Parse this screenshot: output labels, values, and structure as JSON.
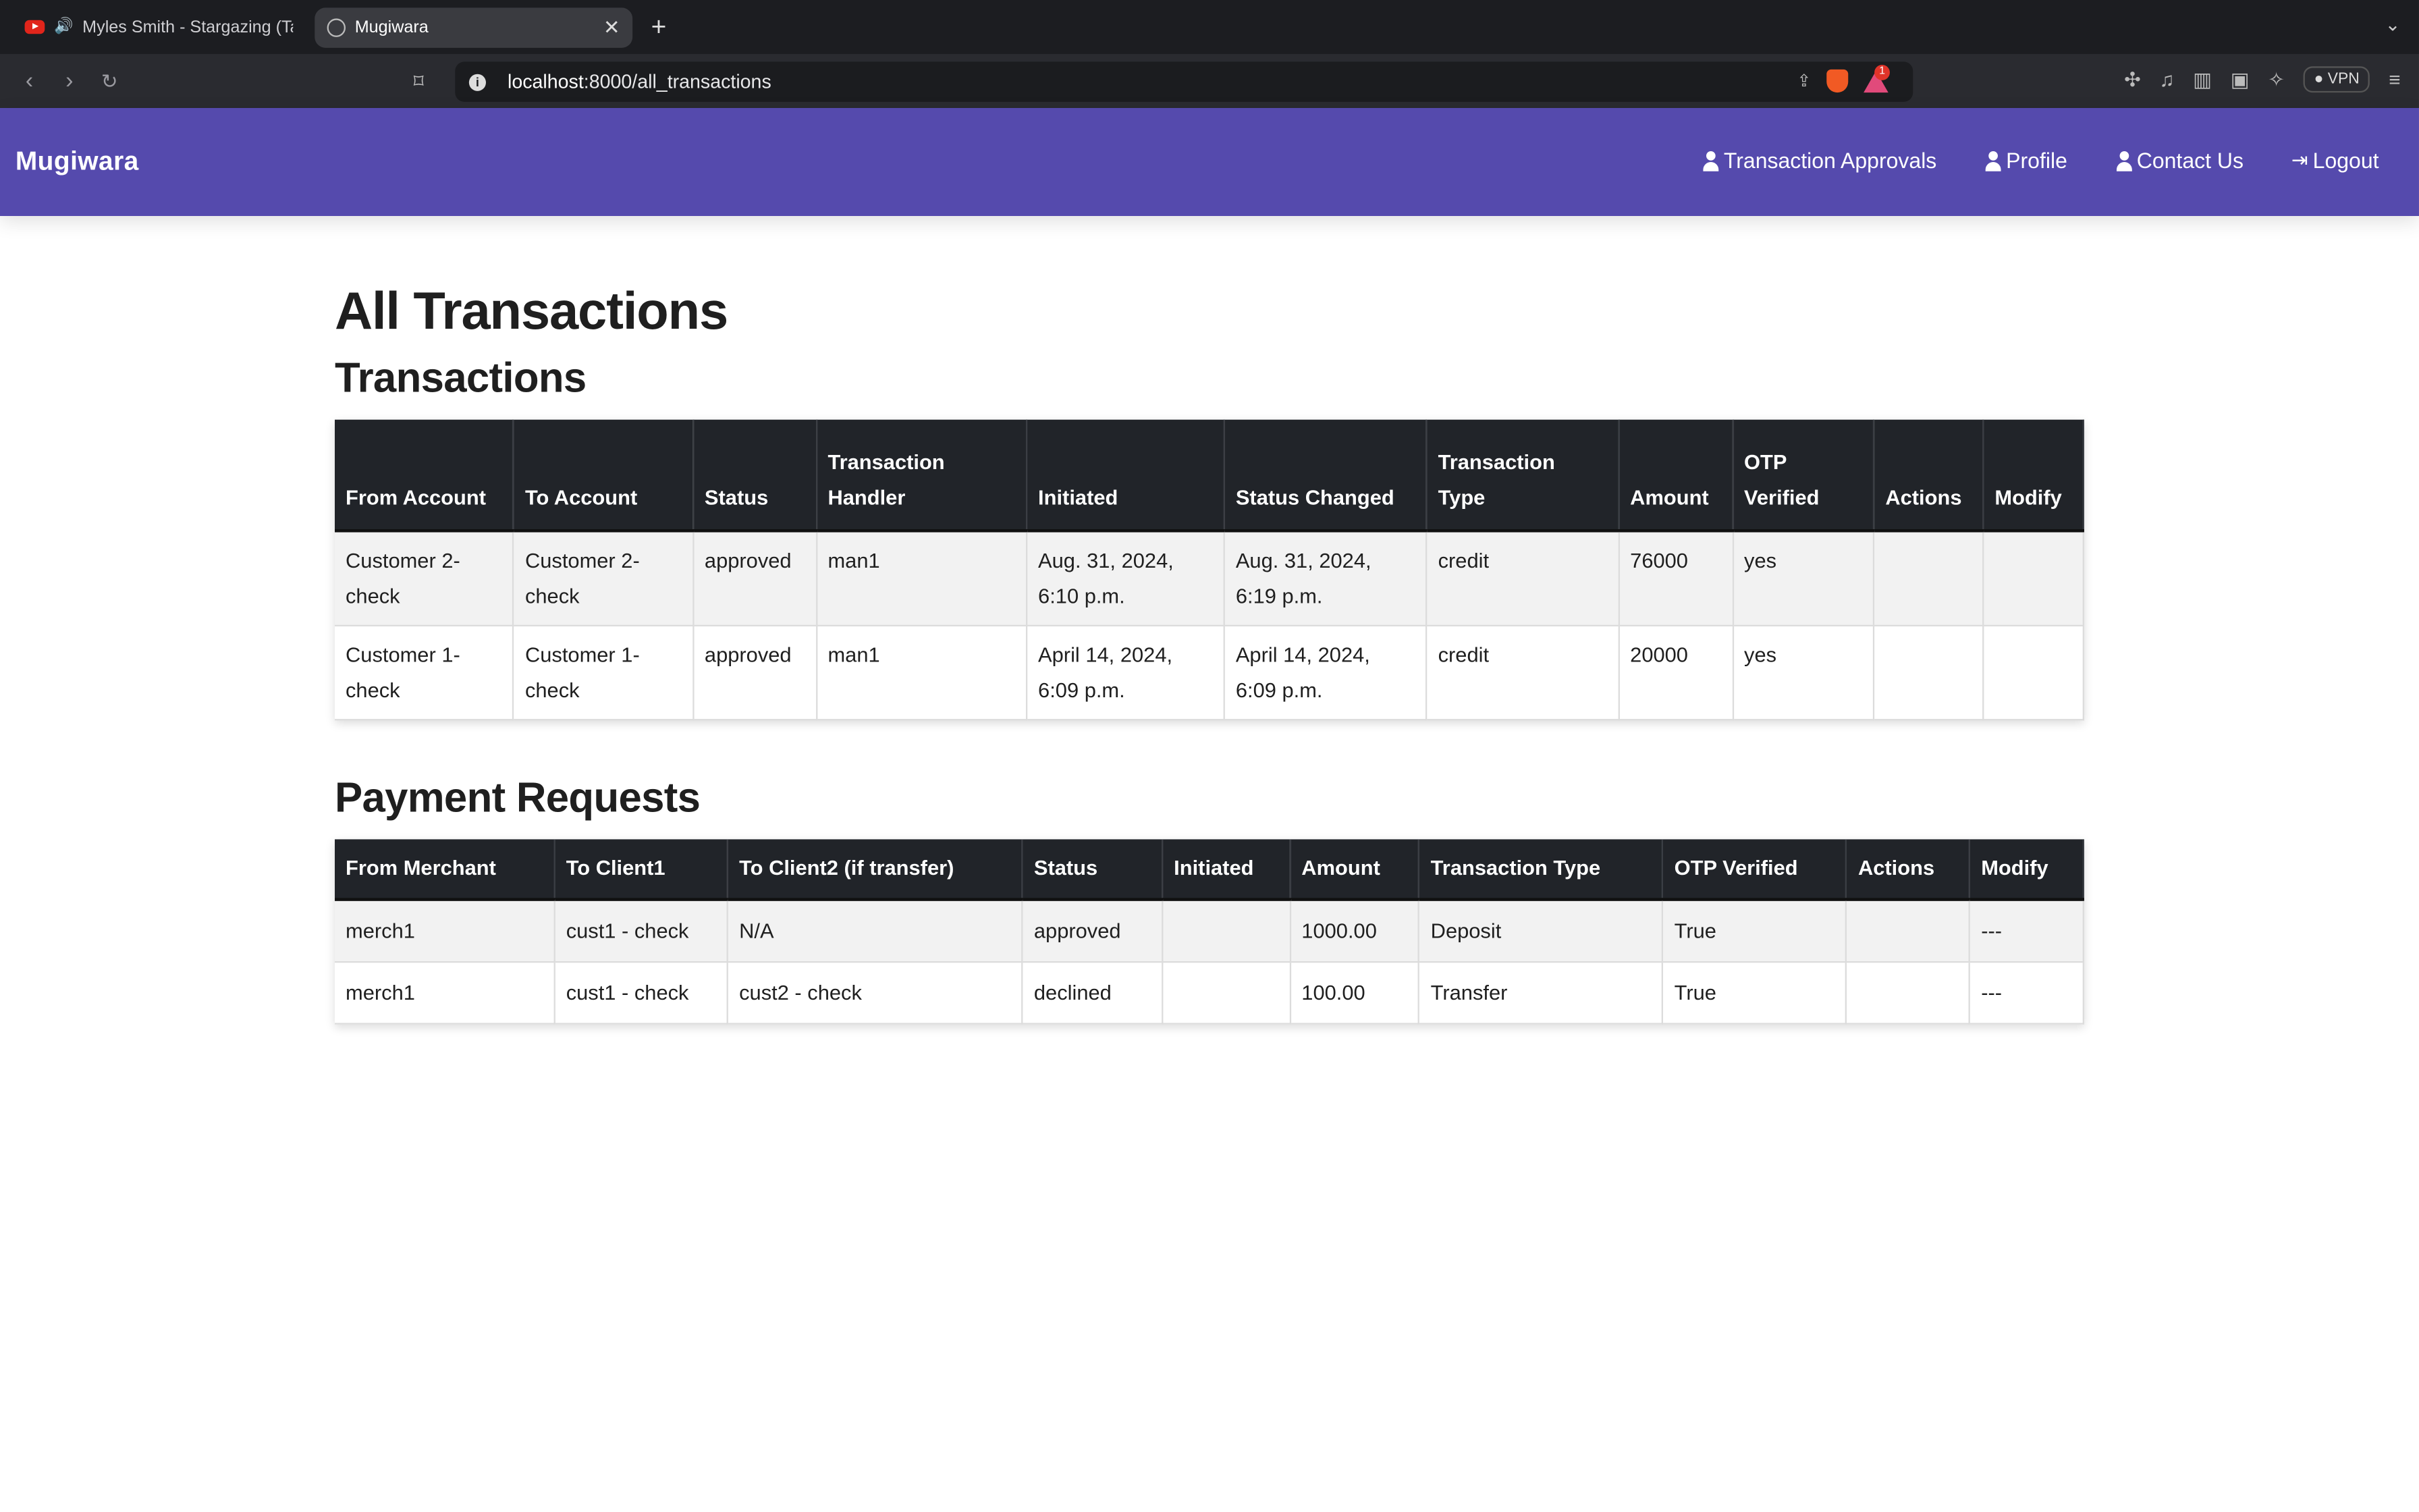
{
  "browser": {
    "tabs": [
      {
        "title": "Myles Smith - Stargazing (Tak",
        "active": false
      },
      {
        "title": "Mugiwara",
        "active": true
      }
    ],
    "url_host": "localhost",
    "url_path": ":8000/all_transactions",
    "vpn_label": "VPN",
    "notification_count": "1"
  },
  "navbar": {
    "brand": "Mugiwara",
    "links": [
      "Transaction Approvals",
      "Profile",
      "Contact Us",
      "Logout"
    ]
  },
  "page": {
    "title": "All Transactions",
    "transactions_heading": "Transactions",
    "payments_heading": "Payment Requests"
  },
  "transactions": {
    "headers": [
      "From Account",
      "To Account",
      "Status",
      "Transaction Handler",
      "Initiated",
      "Status Changed",
      "Transaction Type",
      "Amount",
      "OTP Verified",
      "Actions",
      "Modify"
    ],
    "rows": [
      [
        "Customer 2-check",
        "Customer 2-check",
        "approved",
        "man1",
        "Aug. 31, 2024, 6:10 p.m.",
        "Aug. 31, 2024, 6:19 p.m.",
        "credit",
        "76000",
        "yes",
        "",
        ""
      ],
      [
        "Customer 1-check",
        "Customer 1-check",
        "approved",
        "man1",
        "April 14, 2024, 6:09 p.m.",
        "April 14, 2024, 6:09 p.m.",
        "credit",
        "20000",
        "yes",
        "",
        ""
      ]
    ]
  },
  "payment_requests": {
    "headers": [
      "From Merchant",
      "To Client1",
      "To Client2 (if transfer)",
      "Status",
      "Initiated",
      "Amount",
      "Transaction Type",
      "OTP Verified",
      "Actions",
      "Modify"
    ],
    "rows": [
      [
        "merch1",
        "cust1 - check",
        "N/A",
        "approved",
        "",
        "1000.00",
        "Deposit",
        "True",
        "",
        "---"
      ],
      [
        "merch1",
        "cust1 - check",
        "cust2 - check",
        "declined",
        "",
        "100.00",
        "Transfer",
        "True",
        "",
        "---"
      ]
    ]
  },
  "colors": {
    "navbar_bg": "#554aad",
    "table_header_bg": "#212429"
  }
}
